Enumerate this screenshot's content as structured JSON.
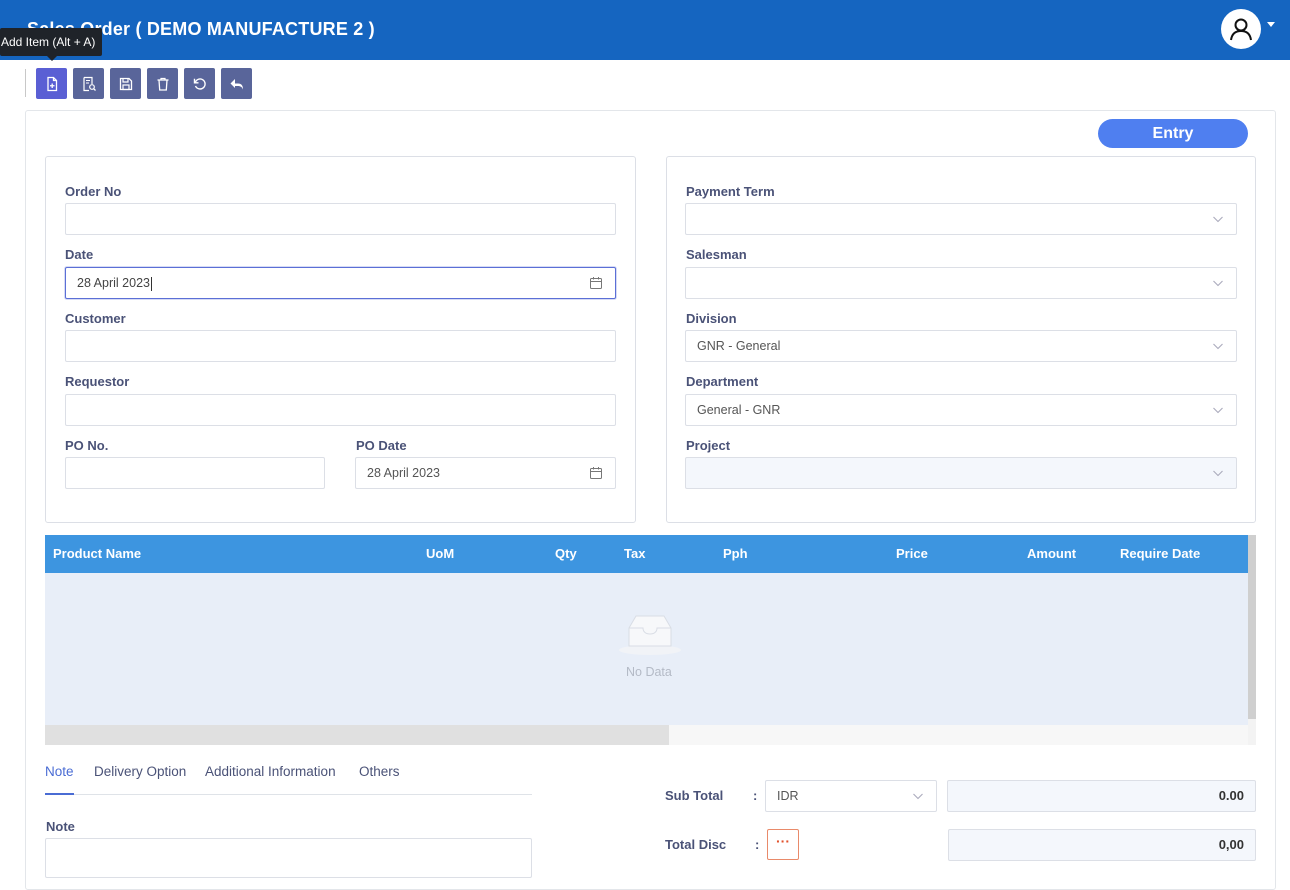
{
  "app": {
    "title": "Sales Order ( DEMO MANUFACTURE 2 )"
  },
  "tooltip": {
    "text": "Add Item (Alt + A)"
  },
  "toolbar": {
    "buttons": [
      {
        "name": "add-item",
        "icon": "file-plus-icon"
      },
      {
        "name": "search",
        "icon": "file-search-icon"
      },
      {
        "name": "save",
        "icon": "save-icon"
      },
      {
        "name": "delete",
        "icon": "trash-icon"
      },
      {
        "name": "refresh",
        "icon": "refresh-icon"
      },
      {
        "name": "back",
        "icon": "reply-icon"
      }
    ]
  },
  "status": {
    "label": "Entry"
  },
  "left_form": {
    "order_no": {
      "label": "Order No",
      "value": ""
    },
    "date": {
      "label": "Date",
      "value": "28 April 2023"
    },
    "customer": {
      "label": "Customer",
      "value": ""
    },
    "requestor": {
      "label": "Requestor",
      "value": ""
    },
    "po_no": {
      "label": "PO No.",
      "value": ""
    },
    "po_date": {
      "label": "PO Date",
      "value": "28 April 2023"
    }
  },
  "right_form": {
    "payment_term": {
      "label": "Payment Term",
      "value": ""
    },
    "salesman": {
      "label": "Salesman",
      "value": ""
    },
    "division": {
      "label": "Division",
      "value": "GNR - General"
    },
    "department": {
      "label": "Department",
      "value": "General - GNR"
    },
    "project": {
      "label": "Project",
      "value": ""
    }
  },
  "table": {
    "columns": [
      "Product Name",
      "UoM",
      "Qty",
      "Tax",
      "Pph",
      "Price",
      "Amount",
      "Require Date"
    ],
    "rows": [],
    "empty_text": "No Data"
  },
  "tabs": [
    {
      "label": "Note",
      "active": true
    },
    {
      "label": "Delivery Option",
      "active": false
    },
    {
      "label": "Additional Information",
      "active": false
    },
    {
      "label": "Others",
      "active": false
    }
  ],
  "note": {
    "label": "Note",
    "value": ""
  },
  "summary": {
    "subtotal": {
      "label": "Sub Total",
      "colon": ":",
      "currency": "IDR",
      "value": "0.00"
    },
    "total_disc": {
      "label": "Total Disc",
      "colon": ":",
      "button": "···",
      "value": "0,00"
    }
  },
  "colors": {
    "topbar": "#1565c0",
    "toolbar_button": "#59659a",
    "toolbar_button_active": "#5a5fd4",
    "status_pill": "#4f7ff0",
    "table_header": "#3d95e0",
    "table_body": "#e8eef8",
    "label": "#4a5277"
  }
}
